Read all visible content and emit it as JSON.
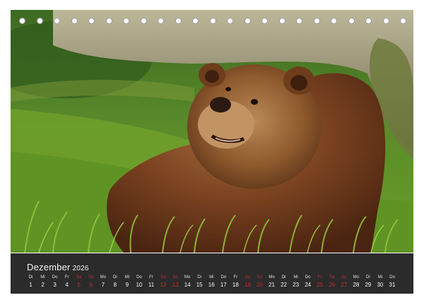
{
  "calendar": {
    "month": "Dezember",
    "year": "2026",
    "days": [
      {
        "wd": "Di",
        "d": "1",
        "type": "normal"
      },
      {
        "wd": "Mi",
        "d": "2",
        "type": "normal"
      },
      {
        "wd": "Do",
        "d": "3",
        "type": "normal"
      },
      {
        "wd": "Fr",
        "d": "4",
        "type": "normal"
      },
      {
        "wd": "Sa",
        "d": "5",
        "type": "sat"
      },
      {
        "wd": "So",
        "d": "6",
        "type": "sun"
      },
      {
        "wd": "Mo",
        "d": "7",
        "type": "normal"
      },
      {
        "wd": "Di",
        "d": "8",
        "type": "normal"
      },
      {
        "wd": "Mi",
        "d": "9",
        "type": "normal"
      },
      {
        "wd": "Do",
        "d": "10",
        "type": "normal"
      },
      {
        "wd": "Fr",
        "d": "11",
        "type": "normal"
      },
      {
        "wd": "Sa",
        "d": "12",
        "type": "sat"
      },
      {
        "wd": "So",
        "d": "13",
        "type": "sun"
      },
      {
        "wd": "Mo",
        "d": "14",
        "type": "normal"
      },
      {
        "wd": "Di",
        "d": "15",
        "type": "normal"
      },
      {
        "wd": "Mi",
        "d": "16",
        "type": "normal"
      },
      {
        "wd": "Do",
        "d": "17",
        "type": "normal"
      },
      {
        "wd": "Fr",
        "d": "18",
        "type": "normal"
      },
      {
        "wd": "Sa",
        "d": "19",
        "type": "sat"
      },
      {
        "wd": "So",
        "d": "20",
        "type": "sun"
      },
      {
        "wd": "Mo",
        "d": "21",
        "type": "normal"
      },
      {
        "wd": "Di",
        "d": "22",
        "type": "normal"
      },
      {
        "wd": "Mi",
        "d": "23",
        "type": "normal"
      },
      {
        "wd": "Do",
        "d": "24",
        "type": "normal"
      },
      {
        "wd": "Fr",
        "d": "25",
        "type": "hol"
      },
      {
        "wd": "Sa",
        "d": "26",
        "type": "sat"
      },
      {
        "wd": "So",
        "d": "27",
        "type": "sun"
      },
      {
        "wd": "Mo",
        "d": "28",
        "type": "normal"
      },
      {
        "wd": "Di",
        "d": "29",
        "type": "normal"
      },
      {
        "wd": "Mi",
        "d": "30",
        "type": "normal"
      },
      {
        "wd": "Do",
        "d": "31",
        "type": "normal"
      }
    ]
  },
  "photo": {
    "subject": "bear-icon",
    "colors": {
      "grass": "#5e8f22",
      "fur": "#6a3a1c",
      "log": "#8f8a70"
    }
  },
  "colors": {
    "calendar_bg": "#2b2b2b",
    "weekend": "#c42a2a",
    "text": "#f5f5f5"
  }
}
